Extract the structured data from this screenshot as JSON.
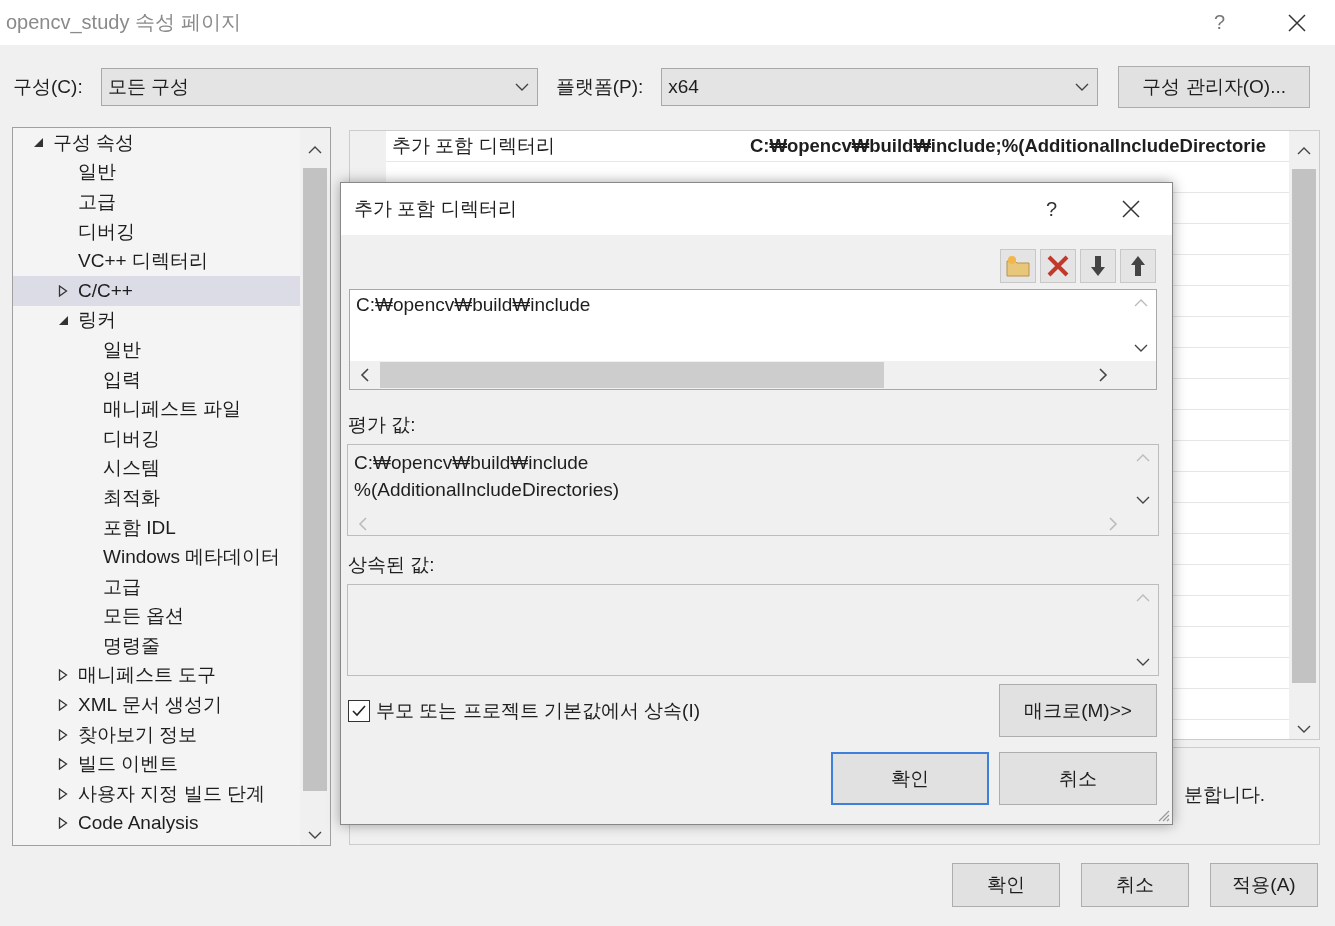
{
  "window": {
    "title": "opencv_study 속성 페이지",
    "help": "?"
  },
  "config": {
    "label": "구성(C):",
    "value": "모든 구성"
  },
  "platform": {
    "label": "플랫폼(P):",
    "value": "x64"
  },
  "config_manager_button": "구성 관리자(O)...",
  "tree": [
    {
      "label": "구성 속성",
      "expanded": true,
      "selected": false,
      "children": [
        {
          "label": "일반",
          "selected": false
        },
        {
          "label": "고급",
          "selected": false
        },
        {
          "label": "디버깅",
          "selected": false
        },
        {
          "label": "VC++ 디렉터리",
          "selected": false
        },
        {
          "label": "C/C++",
          "expanded": false,
          "selected": true
        },
        {
          "label": "링커",
          "expanded": true,
          "selected": false,
          "children": [
            {
              "label": "일반",
              "selected": false
            },
            {
              "label": "입력",
              "selected": false
            },
            {
              "label": "매니페스트 파일",
              "selected": false
            },
            {
              "label": "디버깅",
              "selected": false
            },
            {
              "label": "시스템",
              "selected": false
            },
            {
              "label": "최적화",
              "selected": false
            },
            {
              "label": "포함 IDL",
              "selected": false
            },
            {
              "label": "Windows 메타데이터",
              "selected": false
            },
            {
              "label": "고급",
              "selected": false
            },
            {
              "label": "모든 옵션",
              "selected": false
            },
            {
              "label": "명령줄",
              "selected": false
            }
          ]
        },
        {
          "label": "매니페스트 도구",
          "expanded": false,
          "selected": false
        },
        {
          "label": "XML 문서 생성기",
          "expanded": false,
          "selected": false
        },
        {
          "label": "찾아보기 정보",
          "expanded": false,
          "selected": false
        },
        {
          "label": "빌드 이벤트",
          "expanded": false,
          "selected": false
        },
        {
          "label": "사용자 지정 빌드 단계",
          "expanded": false,
          "selected": false
        },
        {
          "label": "Code Analysis",
          "expanded": false,
          "selected": false
        }
      ]
    }
  ],
  "property_grid": {
    "rows": [
      {
        "name": "추가 포함 디렉터리",
        "value": "C:₩opencv₩build₩include;%(AdditionalIncludeDirectorie",
        "modified": true
      }
    ]
  },
  "description": {
    "lines": [
      "분합니다."
    ]
  },
  "dialog": {
    "title": "추가 포함 디렉터리",
    "help": "?",
    "entries": [
      "C:₩opencv₩build₩include"
    ],
    "evaluated_label": "평가 값:",
    "evaluated": [
      "C:₩opencv₩build₩include",
      "%(AdditionalIncludeDirectories)"
    ],
    "inherited_label": "상속된 값:",
    "inherit": {
      "label": "부모 또는 프로젝트 기본값에서 상속(I)",
      "checked": true
    },
    "macro_button": "매크로(M)>>",
    "ok_button": "확인",
    "cancel_button": "취소"
  },
  "buttons": [
    "확인",
    "취소",
    "적용(A)"
  ]
}
